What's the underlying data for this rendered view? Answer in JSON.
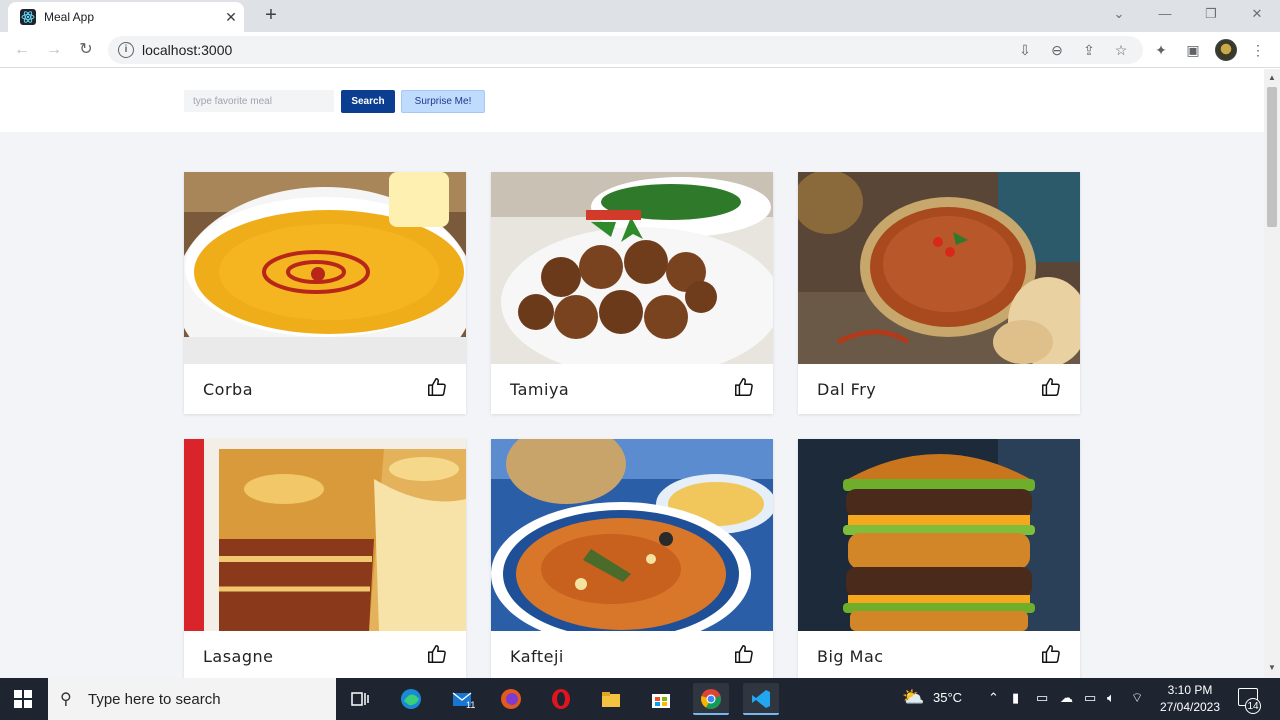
{
  "browser": {
    "tab_title": "Meal App",
    "tab_close": "✕",
    "new_tab": "+",
    "url": "localhost:3000",
    "icons": [
      "react-favicon-icon",
      "back-arrow-icon",
      "forward-arrow-icon",
      "reload-icon",
      "site-info-icon",
      "install-icon",
      "zoom-out-icon",
      "share-icon",
      "bookmark-star-icon",
      "extensions-icon",
      "side-panel-icon",
      "profile-avatar-icon",
      "kebab-menu-icon"
    ]
  },
  "header": {
    "search_placeholder": "type favorite meal",
    "search_label": "Search",
    "surprise_label": "Surprise Me!"
  },
  "meals": [
    {
      "name": "Corba",
      "image": "lentil-soup"
    },
    {
      "name": "Tamiya",
      "image": "falafel"
    },
    {
      "name": "Dal Fry",
      "image": "dal-curry"
    },
    {
      "name": "Lasagne",
      "image": "lasagne"
    },
    {
      "name": "Kafteji",
      "image": "kafteji-plate"
    },
    {
      "name": "Big Mac",
      "image": "double-burger"
    }
  ],
  "taskbar": {
    "search_text": "Type here to search",
    "weather": "35°C",
    "time": "3:10 PM",
    "date": "27/04/2023",
    "mail_badge": "11",
    "notification_count": "14",
    "apps": [
      "task-view-icon",
      "edge-icon",
      "mail-icon",
      "firefox-icon",
      "opera-icon",
      "file-explorer-icon",
      "store-icon",
      "chrome-icon",
      "vscode-icon"
    ]
  },
  "colors": {
    "search_button": "#0b3d91",
    "surprise_button": "#bfdbfe",
    "page_background": "#f2f4f7"
  }
}
